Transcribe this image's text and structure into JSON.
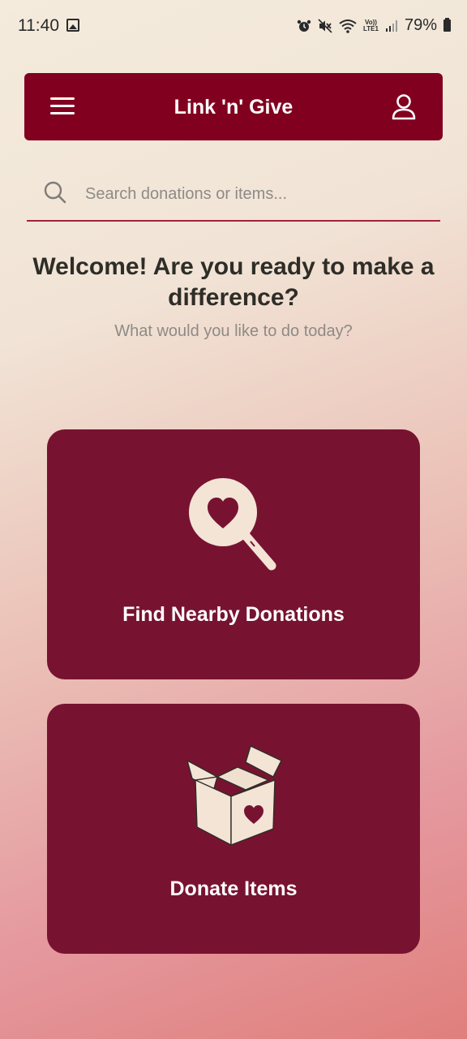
{
  "status_bar": {
    "time": "11:40",
    "volte_label": "Vo))\nLTE1",
    "battery": "79%"
  },
  "app_bar": {
    "title": "Link 'n' Give"
  },
  "search": {
    "placeholder": "Search donations or items..."
  },
  "welcome": {
    "title": "Welcome! Are you ready to make a difference?",
    "subtitle": "What would you like to do today?"
  },
  "cards": [
    {
      "label": "Find Nearby Donations",
      "icon": "heart-magnifier-icon"
    },
    {
      "label": "Donate Items",
      "icon": "heart-box-icon"
    }
  ],
  "colors": {
    "primary": "#82001f",
    "card": "#771330",
    "illustration": "#f3e4d6"
  }
}
